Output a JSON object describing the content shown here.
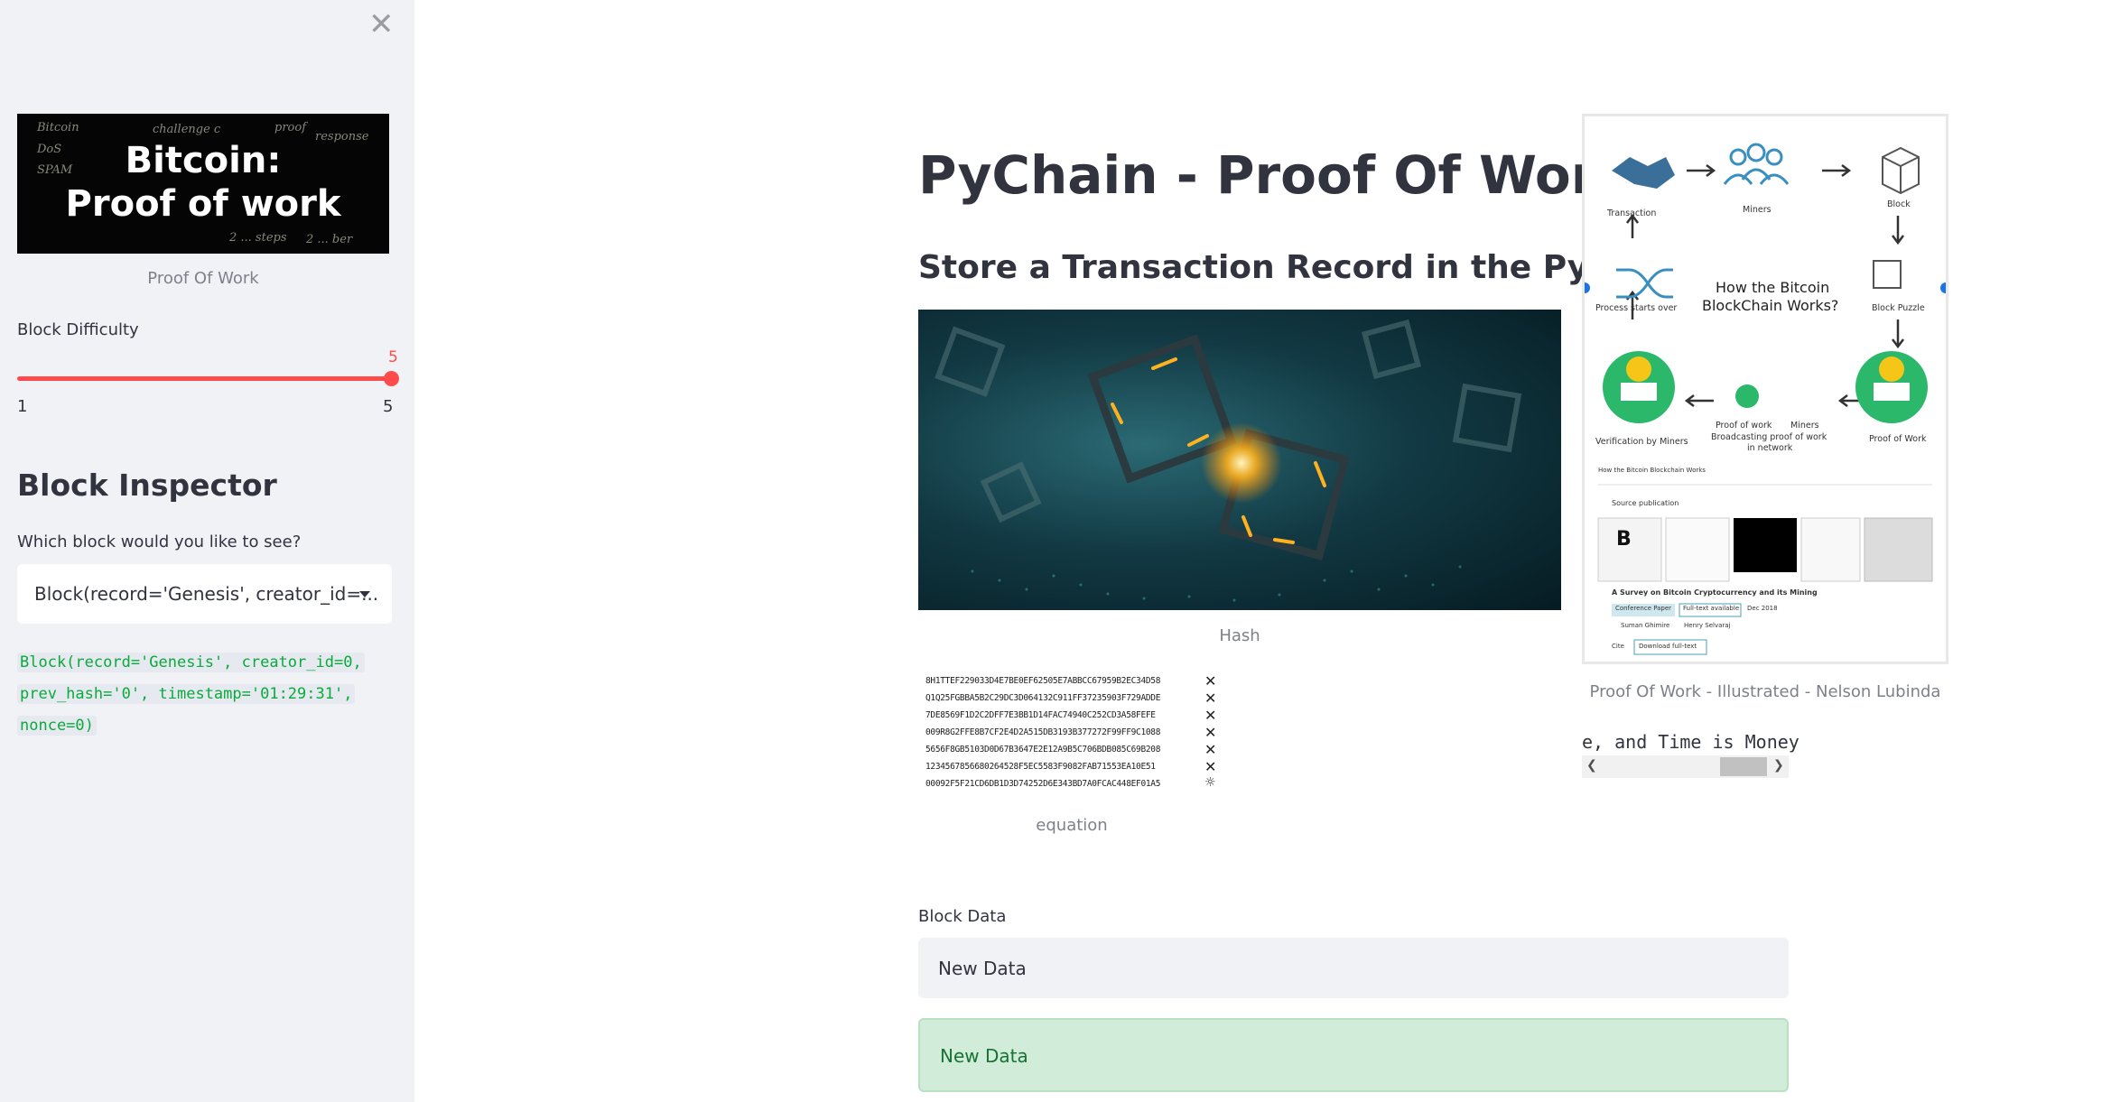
{
  "sidebar": {
    "close_icon": "close-icon",
    "image": {
      "main_text_line1": "Bitcoin:",
      "main_text_line2": "Proof of work",
      "caption": "Proof Of Work"
    },
    "slider": {
      "label": "Block Difficulty",
      "value": "5",
      "min_label": "1",
      "max_label": "5",
      "fraction": 1.0,
      "color": "#ff4b4b"
    },
    "inspector": {
      "title": "Block Inspector",
      "prompt": "Which block would you like to see?",
      "selected": "Block(record='Genesis', creator_id=...",
      "code_lines": [
        "Block(record='Genesis', creator_id=0,",
        "prev_hash='0', timestamp='01:29:31',",
        "nonce=0)"
      ]
    }
  },
  "main": {
    "title": "PyChain - Proof Of Work",
    "subtitle": "Store a Transaction Record in the PyChain",
    "hero_caption": "Hash",
    "equation": {
      "caption": "equation",
      "lines": [
        "8H1TTEF229033D4E7BE0EF62505E7ABBCC67959B2EC34D58",
        "Q1Q25FGBBA5B2C29DC3D064132C911FF37235903F729ADDE",
        "7DE8569F1D2C2DFF7E3BB1D14FAC74940C252CD3A58FEFE",
        "009R8G2FFE8B7CF2E4D2A515DB3193B377272F99FF9C1088",
        "5656F8GB5103D0D67B3647E2E12A9B5C706BDB085C69B208",
        "1234567856680264528F5EC5583F9082FAB71553EA10E51",
        "00092F5F21CD6DB1D3D74252D6E343BD7A0FCAC448EF01A5"
      ]
    },
    "diagram": {
      "caption": "Proof Of Work - Illustrated - Nelson Lubinda",
      "center_line1": "How the Bitcoin",
      "center_line2": "BlockChain Works?",
      "labels": {
        "transaction": "Transaction",
        "miners": "Miners",
        "block": "Block",
        "process": "Process starts over",
        "puzzle": "Block Puzzle",
        "verification": "Verification by Miners",
        "pow_small": "Proof of work",
        "miners_small": "Miners",
        "broadcast1": "Broadcasting proof of work",
        "broadcast2": "in network",
        "pow": "Proof of Work",
        "footer": "How the Bitcoin Blockchain Works",
        "source": "Source publication",
        "paper": "A Survey on Bitcoin Cryptocurrency and its Mining",
        "badge1": "Conference Paper",
        "badge2": "Full-text available",
        "date": "Dec 2018",
        "author1": "Suman Ghimire",
        "author2": "Henry Selvaraj",
        "cite": "Cite",
        "download": "Download full-text"
      }
    },
    "scroll_text": "e, and Time is Money",
    "block_data": {
      "label": "Block Data",
      "input_value": "New Data",
      "success_text": "New Data"
    }
  }
}
